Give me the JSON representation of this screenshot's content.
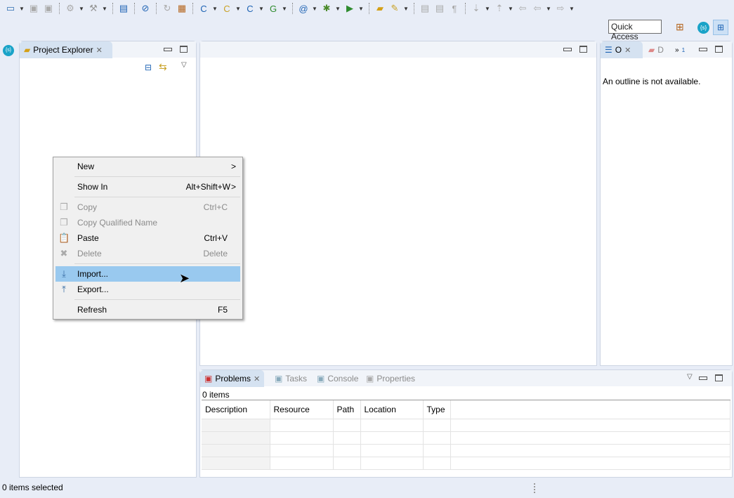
{
  "toolbar": {
    "items": [
      {
        "icon": "new-wizard-icon",
        "glyph": "▭",
        "color": "#2b6cb0",
        "dropdown": true
      },
      {
        "icon": "save-icon",
        "glyph": "▣",
        "color": "#aaa"
      },
      {
        "icon": "save-all-icon",
        "glyph": "▣",
        "color": "#aaa",
        "sep_after": true
      },
      {
        "icon": "debug-config-icon",
        "glyph": "⚙",
        "color": "#aaa",
        "dropdown": true
      },
      {
        "icon": "build-hammer-icon",
        "glyph": "⚒",
        "color": "#999",
        "dropdown": true,
        "sep_after": true
      },
      {
        "icon": "terminal-icon",
        "glyph": "▤",
        "color": "#1e63b4",
        "sep_after": true
      },
      {
        "icon": "skip-breakpoints-icon",
        "glyph": "⊘",
        "color": "#1e63b4",
        "sep_after": true
      },
      {
        "icon": "refresh-target-icon",
        "glyph": "↻",
        "color": "#aaa"
      },
      {
        "icon": "build-targets-icon",
        "glyph": "▦",
        "color": "#b5651d",
        "sep_after": true
      },
      {
        "icon": "new-c-project-icon",
        "glyph": "C",
        "color": "#1e63b4",
        "dropdown": true
      },
      {
        "icon": "new-source-folder-icon",
        "glyph": "C",
        "color": "#c9a227",
        "dropdown": true
      },
      {
        "icon": "new-class-icon",
        "glyph": "C",
        "color": "#1e63b4",
        "dropdown": true
      },
      {
        "icon": "new-cpp-class-icon",
        "glyph": "G",
        "color": "#2e8b2e",
        "dropdown": true,
        "sep_after": true
      },
      {
        "icon": "at-sign-icon",
        "glyph": "@",
        "color": "#1e63b4",
        "dropdown": true
      },
      {
        "icon": "debug-bug-icon",
        "glyph": "✱",
        "color": "#4a8a2a",
        "dropdown": true
      },
      {
        "icon": "run-icon",
        "glyph": "▶",
        "color": "#2e8b2e",
        "dropdown": true,
        "sep_after": true
      },
      {
        "icon": "open-folder-icon",
        "glyph": "▰",
        "color": "#d4a017"
      },
      {
        "icon": "pen-icon",
        "glyph": "✎",
        "color": "#c9a227",
        "dropdown": true,
        "sep_after": true
      },
      {
        "icon": "toggle-mark-icon",
        "glyph": "▤",
        "color": "#aaa"
      },
      {
        "icon": "block-select-icon",
        "glyph": "▤",
        "color": "#aaa"
      },
      {
        "icon": "show-whitespace-icon",
        "glyph": "¶",
        "color": "#aaa",
        "sep_after": true
      },
      {
        "icon": "next-annotation-icon",
        "glyph": "⇣",
        "color": "#aaa",
        "dropdown": true
      },
      {
        "icon": "previous-annotation-icon",
        "glyph": "⇡",
        "color": "#aaa",
        "dropdown": true
      },
      {
        "icon": "last-edit-icon",
        "glyph": "⇦",
        "color": "#aaa"
      },
      {
        "icon": "back-icon",
        "glyph": "⇦",
        "color": "#aaa",
        "dropdown": true
      },
      {
        "icon": "forward-icon",
        "glyph": "⇨",
        "color": "#aaa",
        "dropdown": true
      }
    ]
  },
  "quick_access": "Quick Access",
  "project_explorer": {
    "title": "Project Explorer"
  },
  "outline": {
    "tab_o": "O",
    "tab_d": "D",
    "overflow": "1",
    "message": "An outline is not available."
  },
  "context_menu": [
    {
      "label": "New",
      "arrow": ">",
      "enabled": true
    },
    {
      "label": "Show In",
      "shortcut": "Alt+Shift+W",
      "arrow": ">",
      "enabled": true
    },
    {
      "label": "Copy",
      "shortcut": "Ctrl+C",
      "enabled": false,
      "icon": "copy-icon"
    },
    {
      "label": "Copy Qualified Name",
      "enabled": false,
      "icon": "copy-qualified-name-icon"
    },
    {
      "label": "Paste",
      "shortcut": "Ctrl+V",
      "enabled": true,
      "icon": "paste-icon"
    },
    {
      "label": "Delete",
      "shortcut": "Delete",
      "enabled": false,
      "icon": "delete-icon"
    },
    {
      "label": "Import...",
      "enabled": true,
      "highlighted": true,
      "icon": "import-icon"
    },
    {
      "label": "Export...",
      "enabled": true,
      "icon": "export-icon"
    },
    {
      "label": "Refresh",
      "shortcut": "F5",
      "enabled": true
    }
  ],
  "bottom": {
    "tabs": [
      "Problems",
      "Tasks",
      "Console",
      "Properties"
    ],
    "count": "0 items",
    "columns": [
      "Description",
      "Resource",
      "Path",
      "Location",
      "Type"
    ]
  },
  "status": "0 items selected"
}
